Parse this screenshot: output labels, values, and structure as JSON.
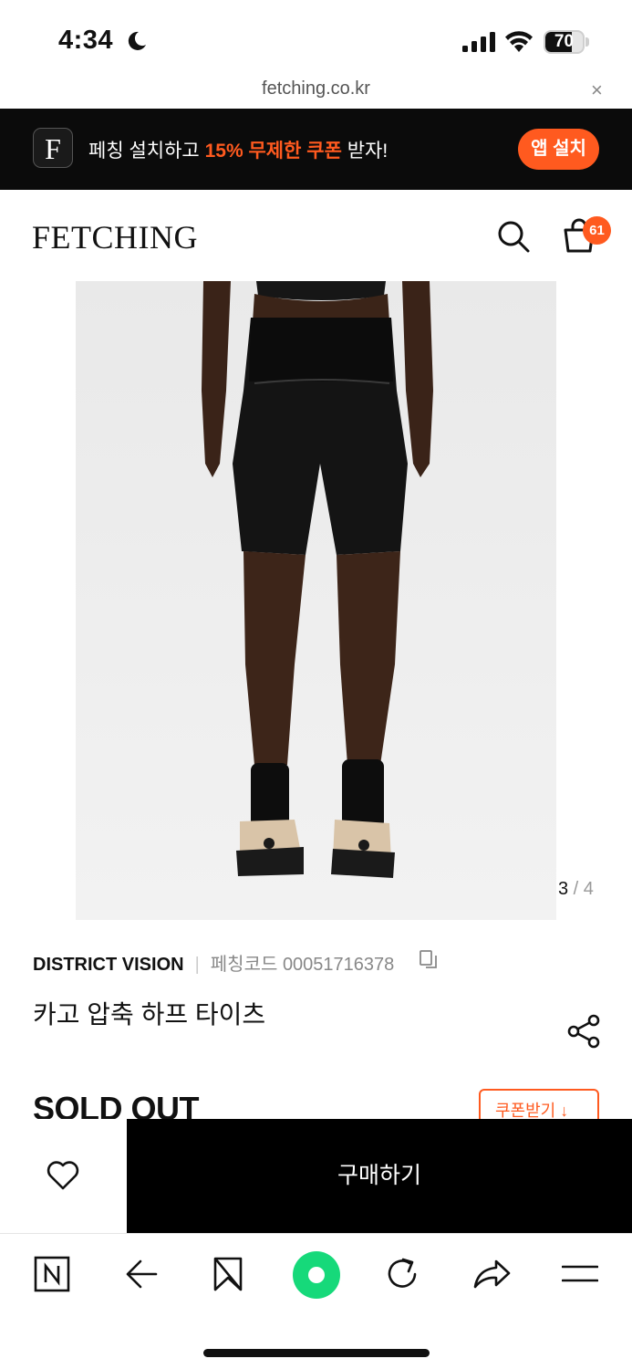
{
  "status_bar": {
    "time": "4:34",
    "battery_level": "70",
    "battery_fraction": 0.7
  },
  "browser": {
    "url": "fetching.co.kr",
    "close_glyph": "×"
  },
  "app_banner": {
    "app_icon_letter": "F",
    "text_before": "페칭 설치하고 ",
    "text_highlight": "15% 무제한 쿠폰",
    "text_after": " 받자!",
    "install_label": "앱 설치",
    "accent_color": "#ff5a1f"
  },
  "header": {
    "logo": "FETCHING",
    "cart_count": "61"
  },
  "product": {
    "image_index": "3",
    "image_total": "4",
    "brand": "DISTRICT VISION",
    "code_label": "페칭코드 00051716378",
    "title": "카고 압축 하프 타이츠",
    "status": "SOLD OUT",
    "coupon_label": "쿠폰받기 ↓"
  },
  "buy_bar": {
    "buy_label": "구매하기"
  },
  "icons": [
    "moon-icon",
    "signal-icon",
    "wifi-icon",
    "battery-icon",
    "close-icon",
    "search-icon",
    "cart-icon",
    "copy-icon",
    "share-icon",
    "heart-icon",
    "naver-home-icon",
    "back-arrow-icon",
    "bookmark-icon",
    "green-dot-icon",
    "refresh-icon",
    "share-arrow-icon",
    "menu-icon"
  ]
}
